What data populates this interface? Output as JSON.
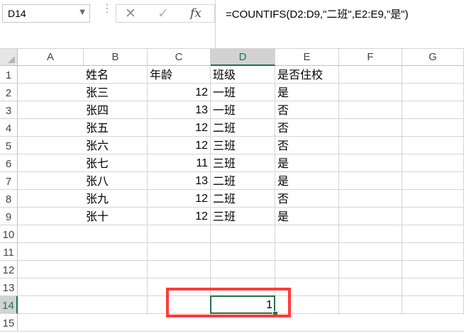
{
  "name_box": {
    "value": "D14",
    "dropdown_icon": "chevron-down-icon"
  },
  "formula_bar": {
    "cancel_icon": "close-icon",
    "enter_icon": "check-icon",
    "function_icon": "fx-icon",
    "cancel_glyph": "✕",
    "enter_glyph": "✓",
    "fx_label": "fx",
    "formula": "=COUNTIFS(D2:D9,\"二班\",E2:E9,\"是\")"
  },
  "columns": [
    "A",
    "B",
    "C",
    "D",
    "E",
    "F",
    "G"
  ],
  "rows": [
    "1",
    "2",
    "3",
    "4",
    "5",
    "6",
    "7",
    "8",
    "9",
    "10",
    "11",
    "12",
    "13",
    "14",
    "15"
  ],
  "active_cell": {
    "column": "D",
    "row": "14",
    "value": "1"
  },
  "table": {
    "headers": [
      "姓名",
      "年龄",
      "班级",
      "是否住校"
    ],
    "records": [
      [
        "张三",
        "12",
        "一班",
        "是"
      ],
      [
        "张四",
        "13",
        "一班",
        "否"
      ],
      [
        "张五",
        "12",
        "二班",
        "否"
      ],
      [
        "张六",
        "12",
        "三班",
        "否"
      ],
      [
        "张七",
        "11",
        "三班",
        "是"
      ],
      [
        "张八",
        "13",
        "二班",
        "是"
      ],
      [
        "张九",
        "12",
        "二班",
        "否"
      ],
      [
        "张十",
        "12",
        "三班",
        "是"
      ]
    ]
  },
  "colors": {
    "selection": "#217346",
    "annotation": "#ff3b3b",
    "header_active_bg": "#d2d2d2"
  }
}
